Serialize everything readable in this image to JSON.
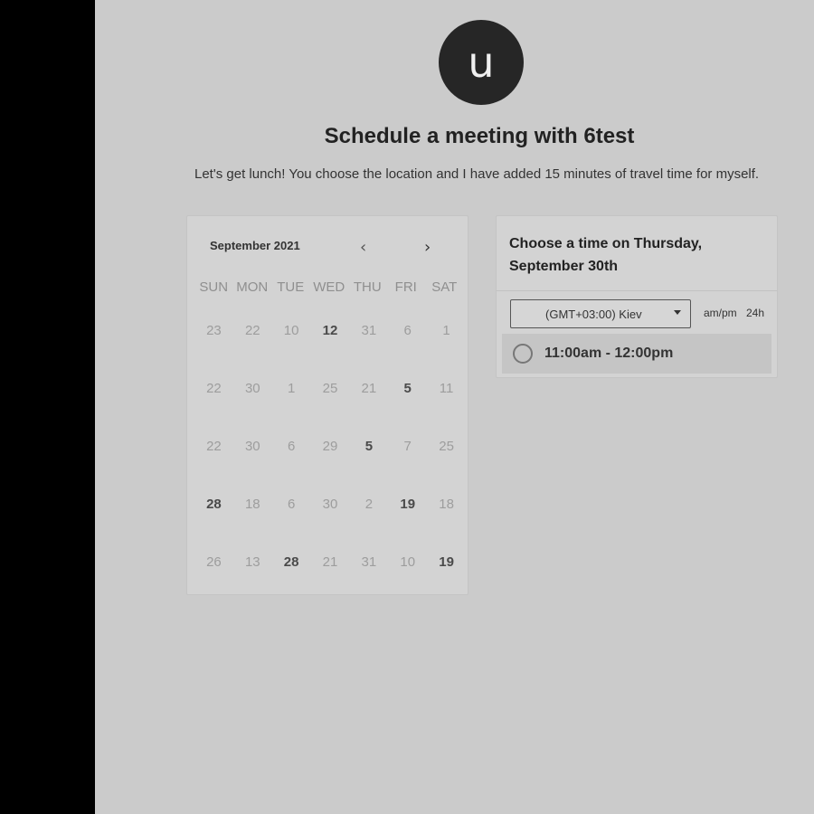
{
  "avatar": {
    "letter": "u"
  },
  "header": {
    "title": "Schedule a meeting with 6test",
    "description": "Let's get lunch! You choose the location and I have added 15 minutes of travel time for myself."
  },
  "calendar": {
    "month_label": "September 2021",
    "prev_icon": "chevron-left-icon",
    "next_icon": "chevron-right-icon",
    "prev_glyph": "‹",
    "next_glyph": "›",
    "weekdays": [
      "SUN",
      "MON",
      "TUE",
      "WED",
      "THU",
      "FRI",
      "SAT"
    ],
    "weeks": [
      [
        {
          "d": "23",
          "a": false
        },
        {
          "d": "22",
          "a": false
        },
        {
          "d": "10",
          "a": false
        },
        {
          "d": "12",
          "a": true
        },
        {
          "d": "31",
          "a": false
        },
        {
          "d": "6",
          "a": false
        },
        {
          "d": "1",
          "a": false
        }
      ],
      [
        {
          "d": "22",
          "a": false
        },
        {
          "d": "30",
          "a": false
        },
        {
          "d": "1",
          "a": false
        },
        {
          "d": "25",
          "a": false
        },
        {
          "d": "21",
          "a": false
        },
        {
          "d": "5",
          "a": true
        },
        {
          "d": "11",
          "a": false
        }
      ],
      [
        {
          "d": "22",
          "a": false
        },
        {
          "d": "30",
          "a": false
        },
        {
          "d": "6",
          "a": false
        },
        {
          "d": "29",
          "a": false
        },
        {
          "d": "5",
          "a": true
        },
        {
          "d": "7",
          "a": false
        },
        {
          "d": "25",
          "a": false
        }
      ],
      [
        {
          "d": "28",
          "a": true
        },
        {
          "d": "18",
          "a": false
        },
        {
          "d": "6",
          "a": false
        },
        {
          "d": "30",
          "a": false
        },
        {
          "d": "2",
          "a": false
        },
        {
          "d": "19",
          "a": true
        },
        {
          "d": "18",
          "a": false
        }
      ],
      [
        {
          "d": "26",
          "a": false
        },
        {
          "d": "13",
          "a": false
        },
        {
          "d": "28",
          "a": true
        },
        {
          "d": "21",
          "a": false
        },
        {
          "d": "31",
          "a": false
        },
        {
          "d": "10",
          "a": false
        },
        {
          "d": "19",
          "a": true
        }
      ]
    ]
  },
  "times": {
    "heading_line1": "Choose a time on Thursday,",
    "heading_line2": "September 30th",
    "timezone": "(GMT+03:00) Kiev",
    "format_ampm": "am/pm",
    "format_24h": "24h",
    "slots": [
      {
        "label": "11:00am - 12:00pm"
      }
    ]
  }
}
